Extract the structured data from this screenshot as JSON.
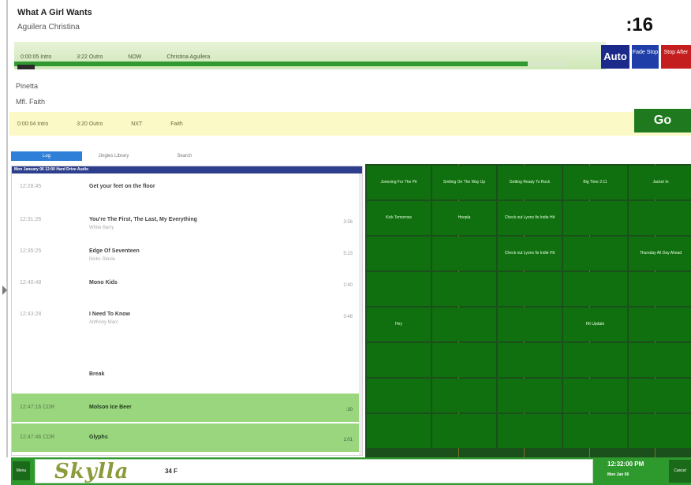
{
  "now_playing": {
    "title": "What A Girl Wants",
    "artist": "Aguilera Christina",
    "countdown": ":16",
    "progress": 0.93,
    "meta": [
      "0:00:05 Intro",
      "3:22 Outro",
      "NOW",
      "Christina Aguilera"
    ]
  },
  "controls": {
    "auto": "Auto",
    "fade_stop": "Fade Stop",
    "stop_after": "Stop After",
    "go": "Go"
  },
  "next_up": {
    "title": "Pinetta",
    "artist": "Mfl. Faith",
    "meta": [
      "0:00:04 Intro",
      "3:20 Outro",
      "NXT",
      "Faith"
    ]
  },
  "tabs": [
    "Log",
    "Jingles Library",
    "Search"
  ],
  "log": {
    "header": "Mon January 06 12:00 Hard Drive Audio",
    "rows": [
      {
        "time": "12:28:45",
        "title": "Get your feet on the floor",
        "artist": "",
        "duration": ""
      },
      {
        "time": "12:31:26",
        "title": "You're The First, The Last, My Everything",
        "artist": "White Barry",
        "duration": "3:56"
      },
      {
        "time": "12:35:25",
        "title": "Edge Of Seventeen",
        "artist": "Nicks Stevie",
        "duration": "5:23"
      },
      {
        "time": "12:40:48",
        "title": "Mono Kids",
        "artist": "",
        "duration": "2:40"
      },
      {
        "time": "12:43:28",
        "title": "I Need To Know",
        "artist": "Anthony Marc",
        "duration": "3:48"
      },
      {
        "time": "",
        "title": "Break",
        "artist": "",
        "duration": ""
      },
      {
        "time": "12:47:16 CDR",
        "title": "Molson Ice Beer",
        "artist": "",
        "duration": ":30"
      },
      {
        "time": "12:47:46 CDR",
        "title": "Glyphs",
        "artist": "",
        "duration": "1:01"
      }
    ]
  },
  "hotkeys": [
    "Jonesing For The Pit",
    "Smiling On The Way Up",
    "Getting Ready To Rock",
    "Big Time 2:11",
    "Jacket In",
    "Kick Tomorrow",
    "Hoopla",
    "Check out Lyons fix Indie Hit",
    "",
    "",
    "",
    "",
    "Check out Lyons fix Indie Hit",
    "",
    "Thursday All Day Ahead",
    "",
    "",
    "",
    "",
    "",
    "Hey",
    "",
    "",
    "Hit Update",
    "",
    "",
    "",
    "",
    "",
    "",
    "",
    "",
    "",
    "",
    "",
    "",
    "",
    "",
    "",
    ""
  ],
  "status": {
    "menu": "Menu",
    "logo": "Skylla",
    "temperature": "34 F",
    "clock": "12:32:00 PM",
    "date": "Mon Jan 06",
    "cancel": "Cancel"
  },
  "colors": {
    "hotkey_green": "#107010",
    "progress_green": "#2f9a2f",
    "auto_blue": "#1b2a8a",
    "stop_red": "#c41e1e",
    "next_yellow": "#fbfac6",
    "log_green": "#9ad67d"
  }
}
